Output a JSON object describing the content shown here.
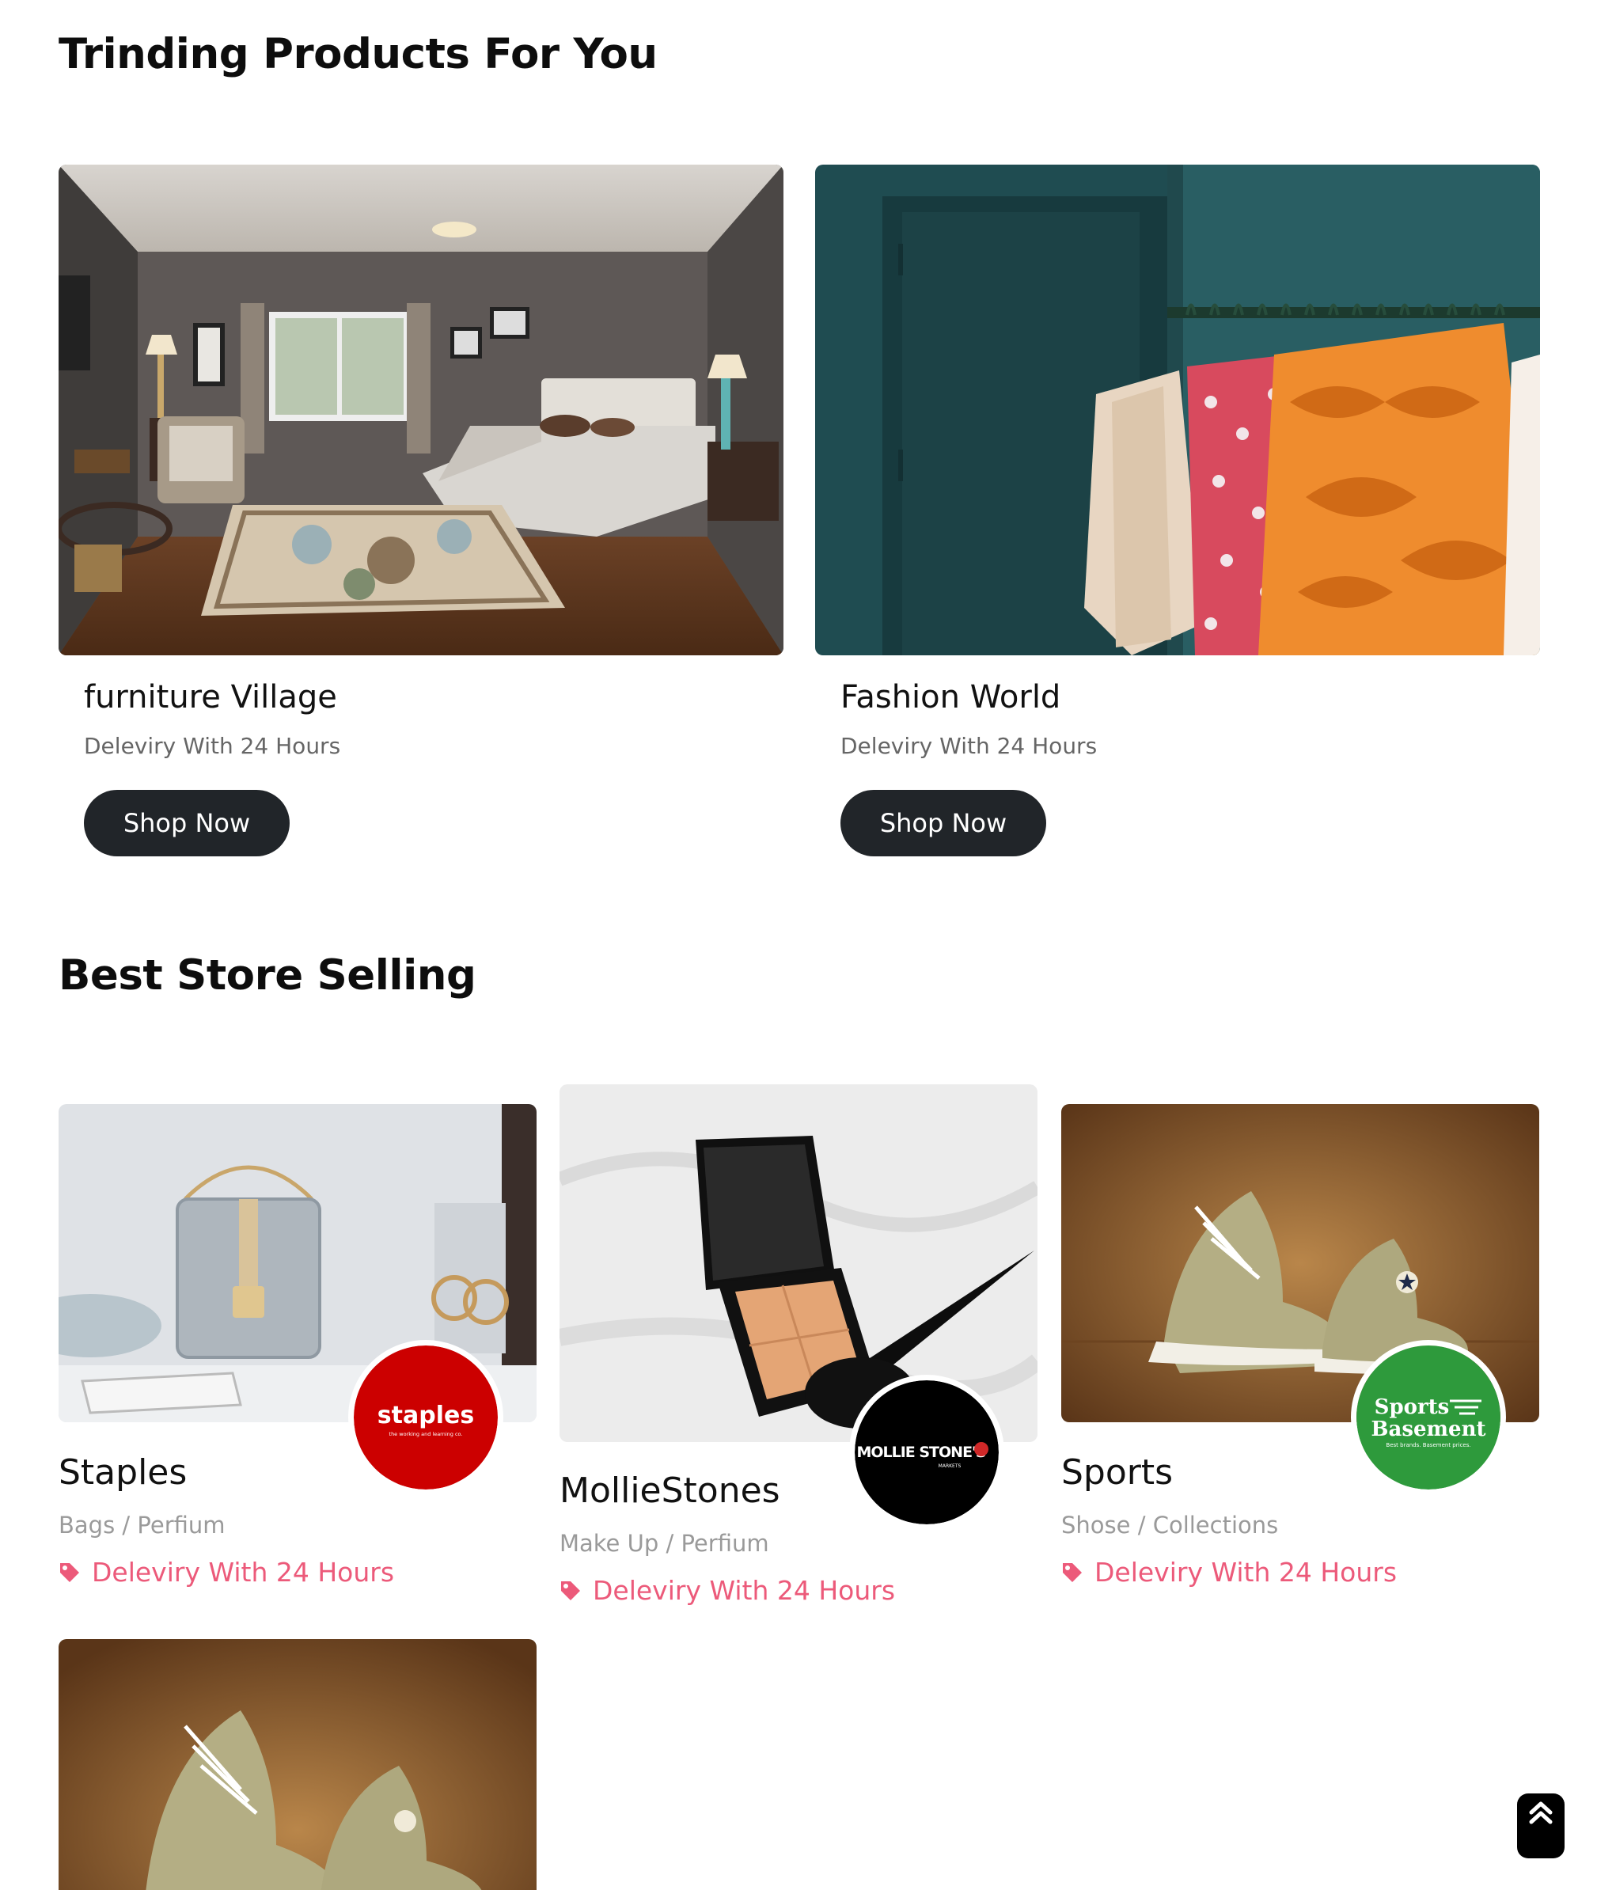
{
  "trending": {
    "title": "Trinding Products For You",
    "cards": [
      {
        "name": "furniture Village",
        "subtitle": "Deleviry With 24 Hours",
        "button": "Shop Now",
        "image": "bedroom-photo"
      },
      {
        "name": "Fashion World",
        "subtitle": "Deleviry With 24 Hours",
        "button": "Shop Now",
        "image": "clothing-rack-photo"
      }
    ]
  },
  "best": {
    "title": "Best Store Selling",
    "stores": [
      {
        "name": "Staples",
        "category_a": "Bags",
        "category_b": "Perfium",
        "delivery": "Deleviry With 24 Hours",
        "logo_text": "staples",
        "logo_sub": "the working and learning co.",
        "logo_color": "#cc0000",
        "image": "handbag-photo"
      },
      {
        "name": "MollieStones",
        "category_a": "Make Up",
        "category_b": "Perfium",
        "delivery": "Deleviry With 24 Hours",
        "logo_text": "MOLLIE STONE'S",
        "logo_sub": "MARKETS",
        "logo_color": "#000000",
        "image": "makeup-palette-photo"
      },
      {
        "name": "Sports",
        "category_a": "Shose",
        "category_b": "Collections",
        "delivery": "Deleviry With 24 Hours",
        "logo_text": "Sports",
        "logo_text2": "Basement",
        "logo_sub": "Best brands. Basement prices.",
        "logo_color": "#2e9a3c",
        "image": "sneakers-photo"
      }
    ]
  },
  "colors": {
    "accent_pink": "#ec5a7a",
    "button_dark": "#212529"
  },
  "scroll_top_icon": "double-chevron-up-icon"
}
